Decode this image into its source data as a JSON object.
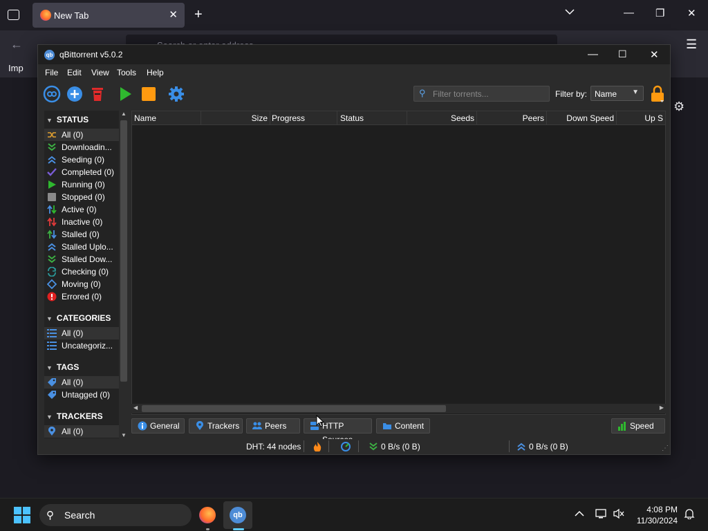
{
  "browser": {
    "tab_title": "New Tab",
    "url_placeholder": "Search or enter address",
    "bookmark": "Imp"
  },
  "window": {
    "title": "qBittorrent v5.0.2"
  },
  "menu": [
    "File",
    "Edit",
    "View",
    "Tools",
    "Help"
  ],
  "toolbar": {
    "filter_placeholder": "Filter torrents...",
    "filter_by_label": "Filter by:",
    "filter_by_value": "Name"
  },
  "sidebar": {
    "status_title": "STATUS",
    "status": [
      {
        "label": "All (0)",
        "icon": "all-icon",
        "color": "#e0a030"
      },
      {
        "label": "Downloadin...",
        "icon": "downloading-icon",
        "color": "#3cb043"
      },
      {
        "label": "Seeding (0)",
        "icon": "seeding-icon",
        "color": "#4a90e2"
      },
      {
        "label": "Completed (0)",
        "icon": "completed-icon",
        "color": "#7a5cd6"
      },
      {
        "label": "Running (0)",
        "icon": "running-icon",
        "color": "#2fb82f"
      },
      {
        "label": "Stopped (0)",
        "icon": "stopped-icon",
        "color": "#8a8a8a"
      },
      {
        "label": "Active (0)",
        "icon": "active-icon",
        "color": "#2fb82f"
      },
      {
        "label": "Inactive (0)",
        "icon": "inactive-icon",
        "color": "#e03a3a"
      },
      {
        "label": "Stalled (0)",
        "icon": "stalled-icon",
        "color": "#3cb043"
      },
      {
        "label": "Stalled Uplo...",
        "icon": "stalled-upload-icon",
        "color": "#4a90e2"
      },
      {
        "label": "Stalled Dow...",
        "icon": "stalled-download-icon",
        "color": "#3cb043"
      },
      {
        "label": "Checking (0)",
        "icon": "checking-icon",
        "color": "#2a9a9a"
      },
      {
        "label": "Moving (0)",
        "icon": "moving-icon",
        "color": "#4a90e2"
      },
      {
        "label": "Errored (0)",
        "icon": "errored-icon",
        "color": "#e02020"
      }
    ],
    "categories_title": "CATEGORIES",
    "categories": [
      "All (0)",
      "Uncategoriz..."
    ],
    "tags_title": "TAGS",
    "tags": [
      "All (0)",
      "Untagged (0)"
    ],
    "trackers_title": "TRACKERS",
    "trackers": [
      "All (0)"
    ]
  },
  "table": {
    "columns": [
      "Name",
      "Size",
      "Progress",
      "Status",
      "Seeds",
      "Peers",
      "Down Speed",
      "Up S"
    ]
  },
  "bottom_tabs": [
    "General",
    "Trackers",
    "Peers",
    "HTTP Sources",
    "Content"
  ],
  "speed_button": "Speed",
  "statusbar": {
    "dht": "DHT: 44 nodes",
    "down": "0 B/s (0 B)",
    "up": "0 B/s (0 B)"
  },
  "taskbar": {
    "search": "Search",
    "time": "4:08 PM",
    "date": "11/30/2024"
  }
}
